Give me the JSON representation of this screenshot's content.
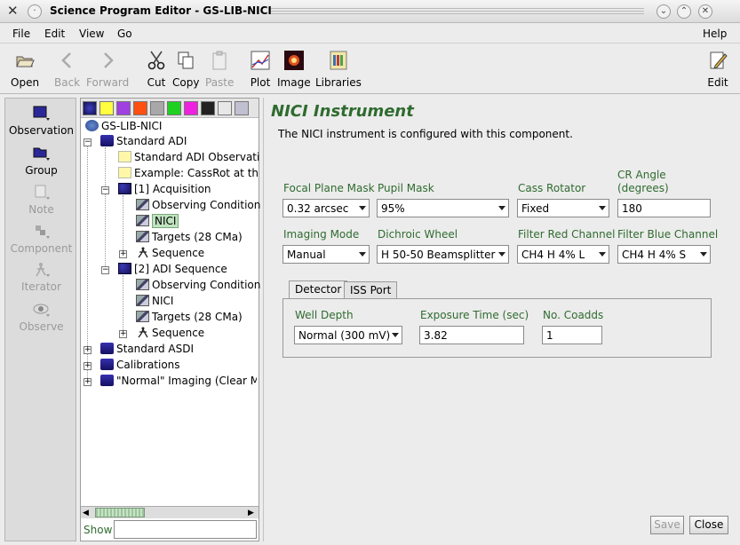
{
  "window": {
    "title": "Science Program Editor - GS-LIB-NICI"
  },
  "menu": {
    "file": "File",
    "edit": "Edit",
    "view": "View",
    "go": "Go",
    "help": "Help"
  },
  "toolbar": {
    "open": "Open",
    "back": "Back",
    "forward": "Forward",
    "cut": "Cut",
    "copy": "Copy",
    "paste": "Paste",
    "plot": "Plot",
    "image": "Image",
    "libraries": "Libraries",
    "edit": "Edit"
  },
  "palette": {
    "observation": "Observation",
    "group": "Group",
    "note": "Note",
    "component": "Component",
    "iterator": "Iterator",
    "observe": "Observe"
  },
  "tree": {
    "root": "GS-LIB-NICI",
    "n1": "Standard ADI",
    "n2": "Standard ADI Observati",
    "n3": "Example: CassRot at th",
    "n4": "[1] Acquisition",
    "n5": "Observing Condition",
    "n6": "NICI",
    "n7": "Targets (28 CMa)",
    "n8": "Sequence",
    "n9": "[2] ADI Sequence",
    "n10": "Observing Condition",
    "n11": "NICI",
    "n12": "Targets (28 CMa)",
    "n13": "Sequence",
    "n14": "Standard ASDI",
    "n15": "Calibrations",
    "n16": "\"Normal\" Imaging (Clear Ma"
  },
  "show": {
    "label": "Show",
    "value": ""
  },
  "instrument": {
    "title": "NICI Instrument",
    "description": "The NICI instrument is configured with this component.",
    "focal_plane_mask": {
      "label": "Focal Plane Mask",
      "value": "0.32 arcsec"
    },
    "pupil_mask": {
      "label": "Pupil Mask",
      "value": "95%"
    },
    "cass_rotator": {
      "label": "Cass Rotator",
      "value": "Fixed"
    },
    "cr_angle": {
      "label1": "CR Angle",
      "label2": "(degrees)",
      "value": "180"
    },
    "imaging_mode": {
      "label": "Imaging Mode",
      "value": "Manual"
    },
    "dichroic_wheel": {
      "label": "Dichroic Wheel",
      "value": "H 50-50 Beamsplitter"
    },
    "filter_red": {
      "label": "Filter Red Channel",
      "value": "CH4 H 4% L"
    },
    "filter_blue": {
      "label": "Filter Blue Channel",
      "value": "CH4 H 4% S"
    },
    "tabs": {
      "detector": "Detector",
      "iss_port": "ISS Port"
    },
    "well_depth": {
      "label": "Well Depth",
      "value": "Normal (300 mV)"
    },
    "exposure_time": {
      "label": "Exposure Time (sec)",
      "value": "3.82"
    },
    "coadds": {
      "label": "No. Coadds",
      "value": "1"
    },
    "save": "Save",
    "close": "Close"
  }
}
